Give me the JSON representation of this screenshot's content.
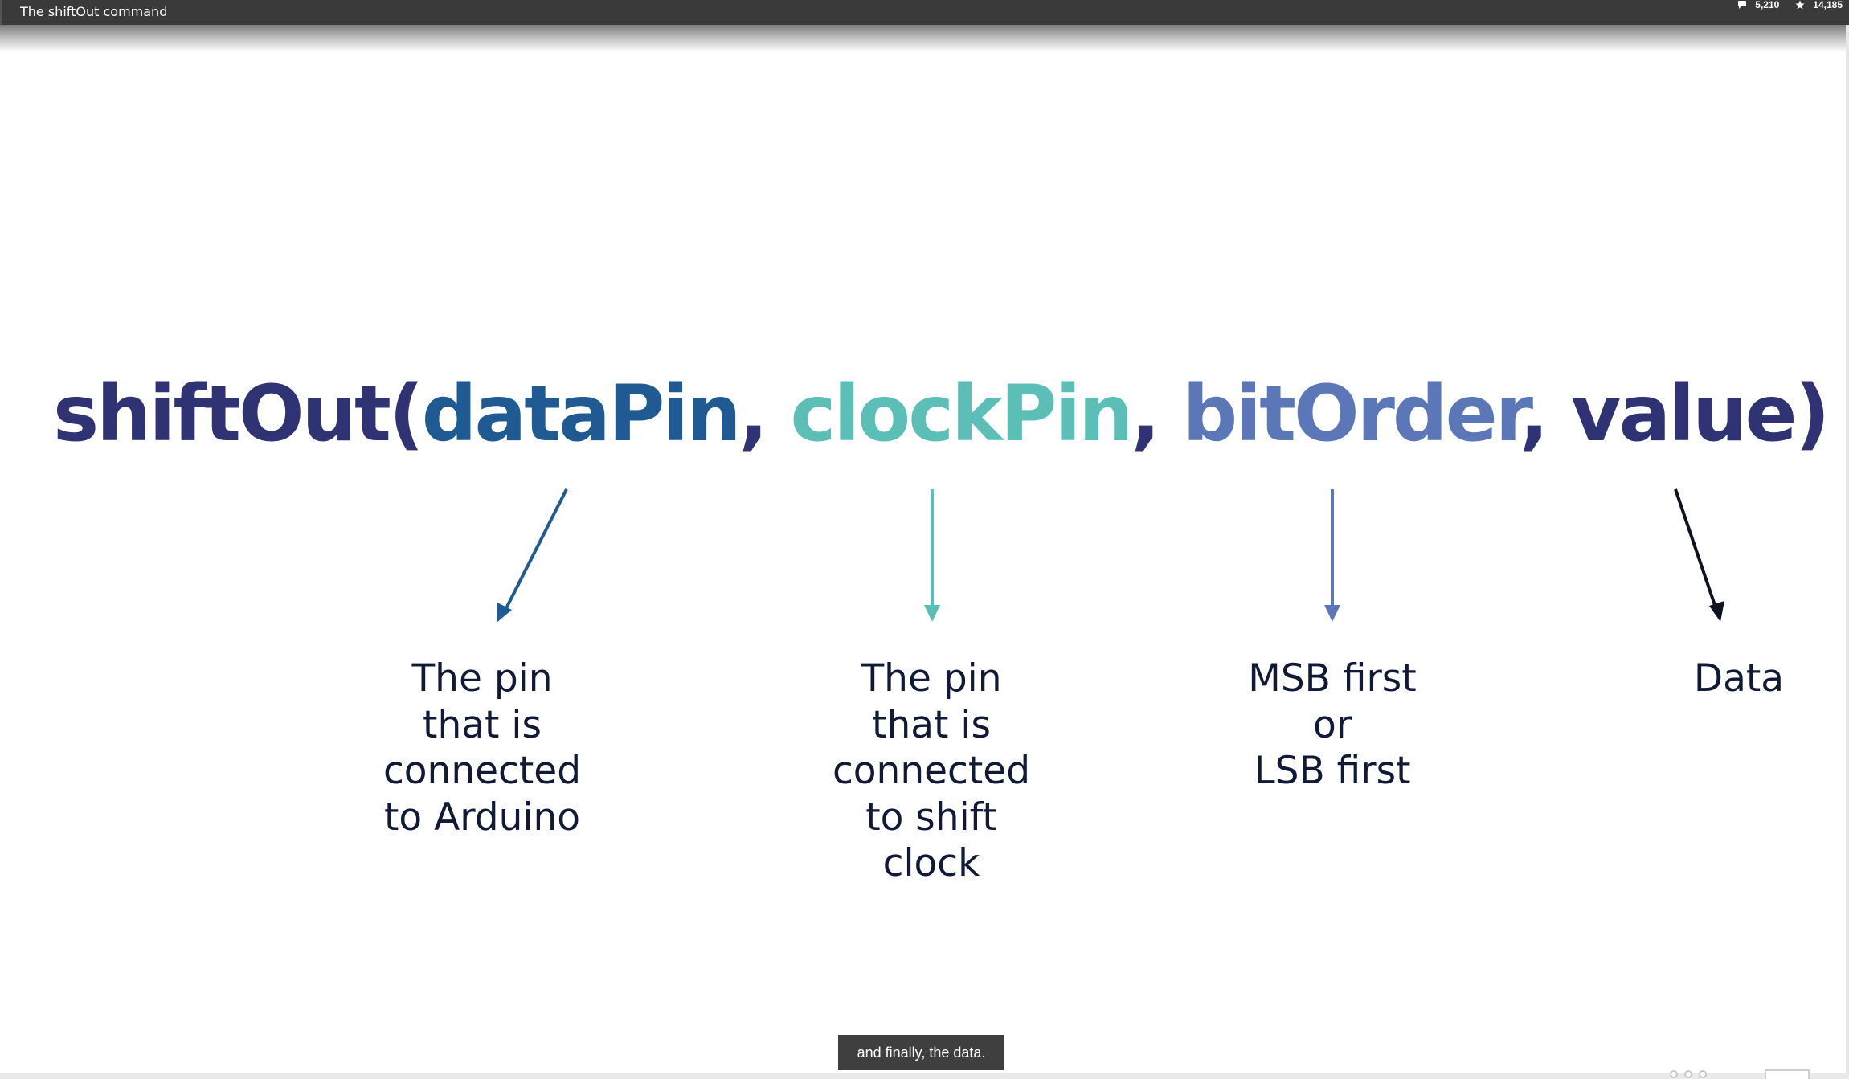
{
  "window": {
    "title": "The shiftOut command",
    "stats": {
      "views": "5,210",
      "bookmarks": "14,185"
    }
  },
  "slide": {
    "formula": {
      "fn": "shiftOut(",
      "arg1": "dataPin",
      "sep1": ", ",
      "arg2": "clockPin",
      "sep2": ", ",
      "arg3": "bitOrder",
      "sep3": ", ",
      "arg4": "value)"
    },
    "descriptions": [
      {
        "lines": [
          "The pin",
          "that is",
          "connected",
          "to Arduino"
        ]
      },
      {
        "lines": [
          "The pin",
          "that is",
          "connected",
          "to shift",
          "clock"
        ]
      },
      {
        "lines": [
          "MSB first",
          "or",
          "LSB first"
        ]
      },
      {
        "lines": [
          "Data"
        ]
      }
    ],
    "colors": {
      "navy": "#2f3373",
      "blue": "#1f5a93",
      "teal": "#5cbfb7",
      "steel": "#5b77b8",
      "black": "#0f1220"
    }
  },
  "player": {
    "caption": "and finally, the data."
  },
  "icons": [
    "chat-icon",
    "star-icon",
    "arrow-down-left-icon",
    "arrow-down-icon",
    "arrow-down-right-icon"
  ]
}
